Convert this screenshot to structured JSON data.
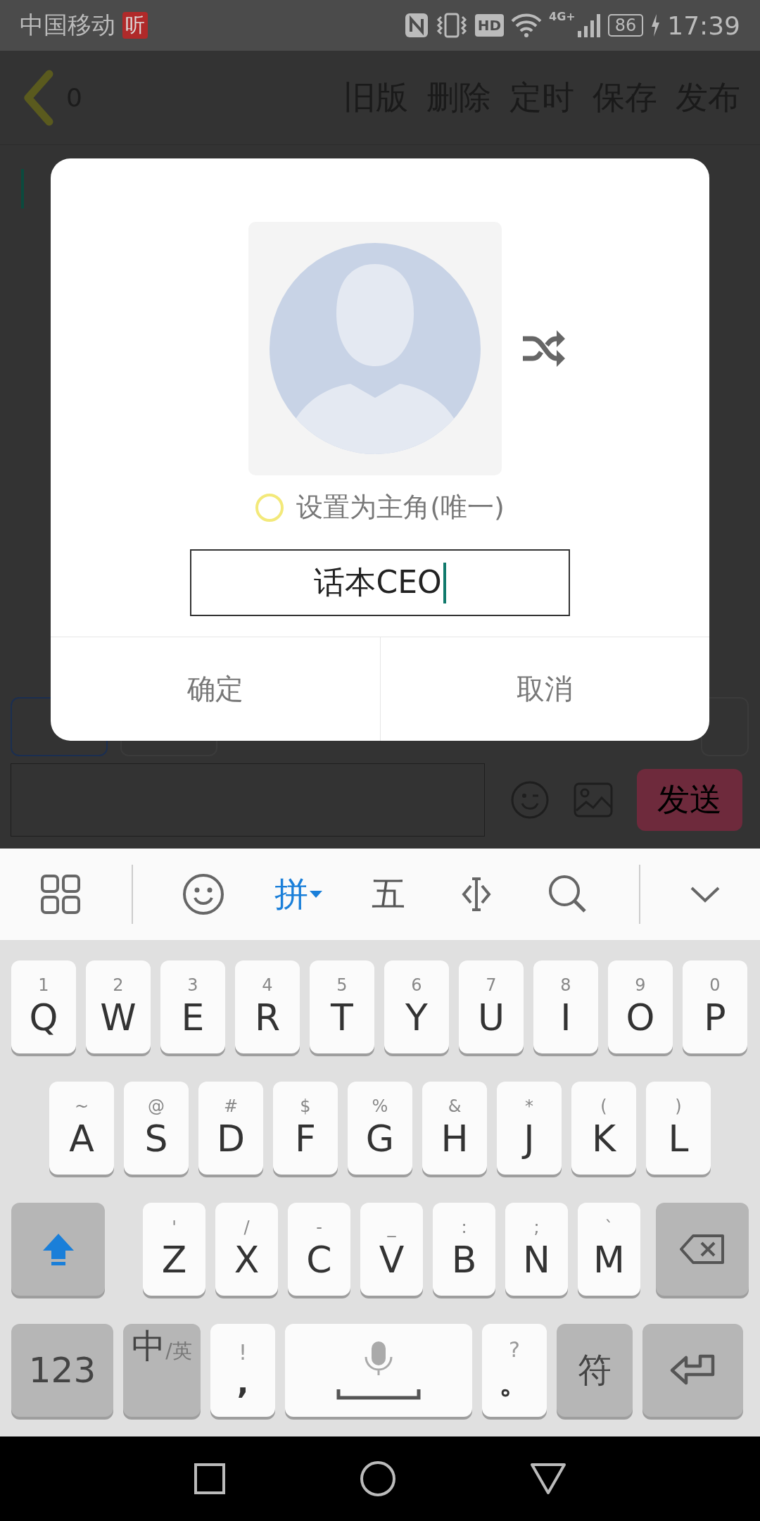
{
  "status_bar": {
    "carrier": "中国移动",
    "app_badge": "听",
    "hd": "HD",
    "network": "4G+",
    "battery": "86",
    "time": "17:39"
  },
  "app_bar": {
    "count": "0",
    "actions": [
      "旧版",
      "删除",
      "定时",
      "保存",
      "发布"
    ]
  },
  "composer": {
    "send": "发送"
  },
  "dialog": {
    "protagonist": {
      "label": "设置为主角(唯一)",
      "selected": false
    },
    "name_field": {
      "value": "话本CEO"
    },
    "buttons": [
      "确定",
      "取消"
    ]
  },
  "keyboard": {
    "input_modes": [
      {
        "label": "拼",
        "selected": true
      },
      {
        "label": "五",
        "selected": false
      }
    ],
    "rows": [
      [
        {
          "label": "Q",
          "hint": "1"
        },
        {
          "label": "W",
          "hint": "2"
        },
        {
          "label": "E",
          "hint": "3"
        },
        {
          "label": "R",
          "hint": "4"
        },
        {
          "label": "T",
          "hint": "5"
        },
        {
          "label": "Y",
          "hint": "6"
        },
        {
          "label": "U",
          "hint": "7"
        },
        {
          "label": "I",
          "hint": "8"
        },
        {
          "label": "O",
          "hint": "9"
        },
        {
          "label": "P",
          "hint": "0"
        }
      ],
      [
        {
          "label": "A",
          "hint": "~"
        },
        {
          "label": "S",
          "hint": "@"
        },
        {
          "label": "D",
          "hint": "#"
        },
        {
          "label": "F",
          "hint": "$"
        },
        {
          "label": "G",
          "hint": "%"
        },
        {
          "label": "H",
          "hint": "&"
        },
        {
          "label": "J",
          "hint": "*"
        },
        {
          "label": "K",
          "hint": "("
        },
        {
          "label": "L",
          "hint": ")"
        }
      ],
      [
        {
          "label": "Z",
          "hint": "'"
        },
        {
          "label": "X",
          "hint": "/"
        },
        {
          "label": "C",
          "hint": "-"
        },
        {
          "label": "V",
          "hint": "_"
        },
        {
          "label": "B",
          "hint": ":"
        },
        {
          "label": "N",
          "hint": ";"
        },
        {
          "label": "M",
          "hint": "`"
        }
      ]
    ],
    "numbers_key": "123",
    "lang_key": {
      "main": "中",
      "alt": "/英"
    },
    "comma_key": {
      "label": ",",
      "hint": "!"
    },
    "period_key": {
      "label": "。",
      "hint": "?"
    },
    "symbols_key": "符"
  }
}
